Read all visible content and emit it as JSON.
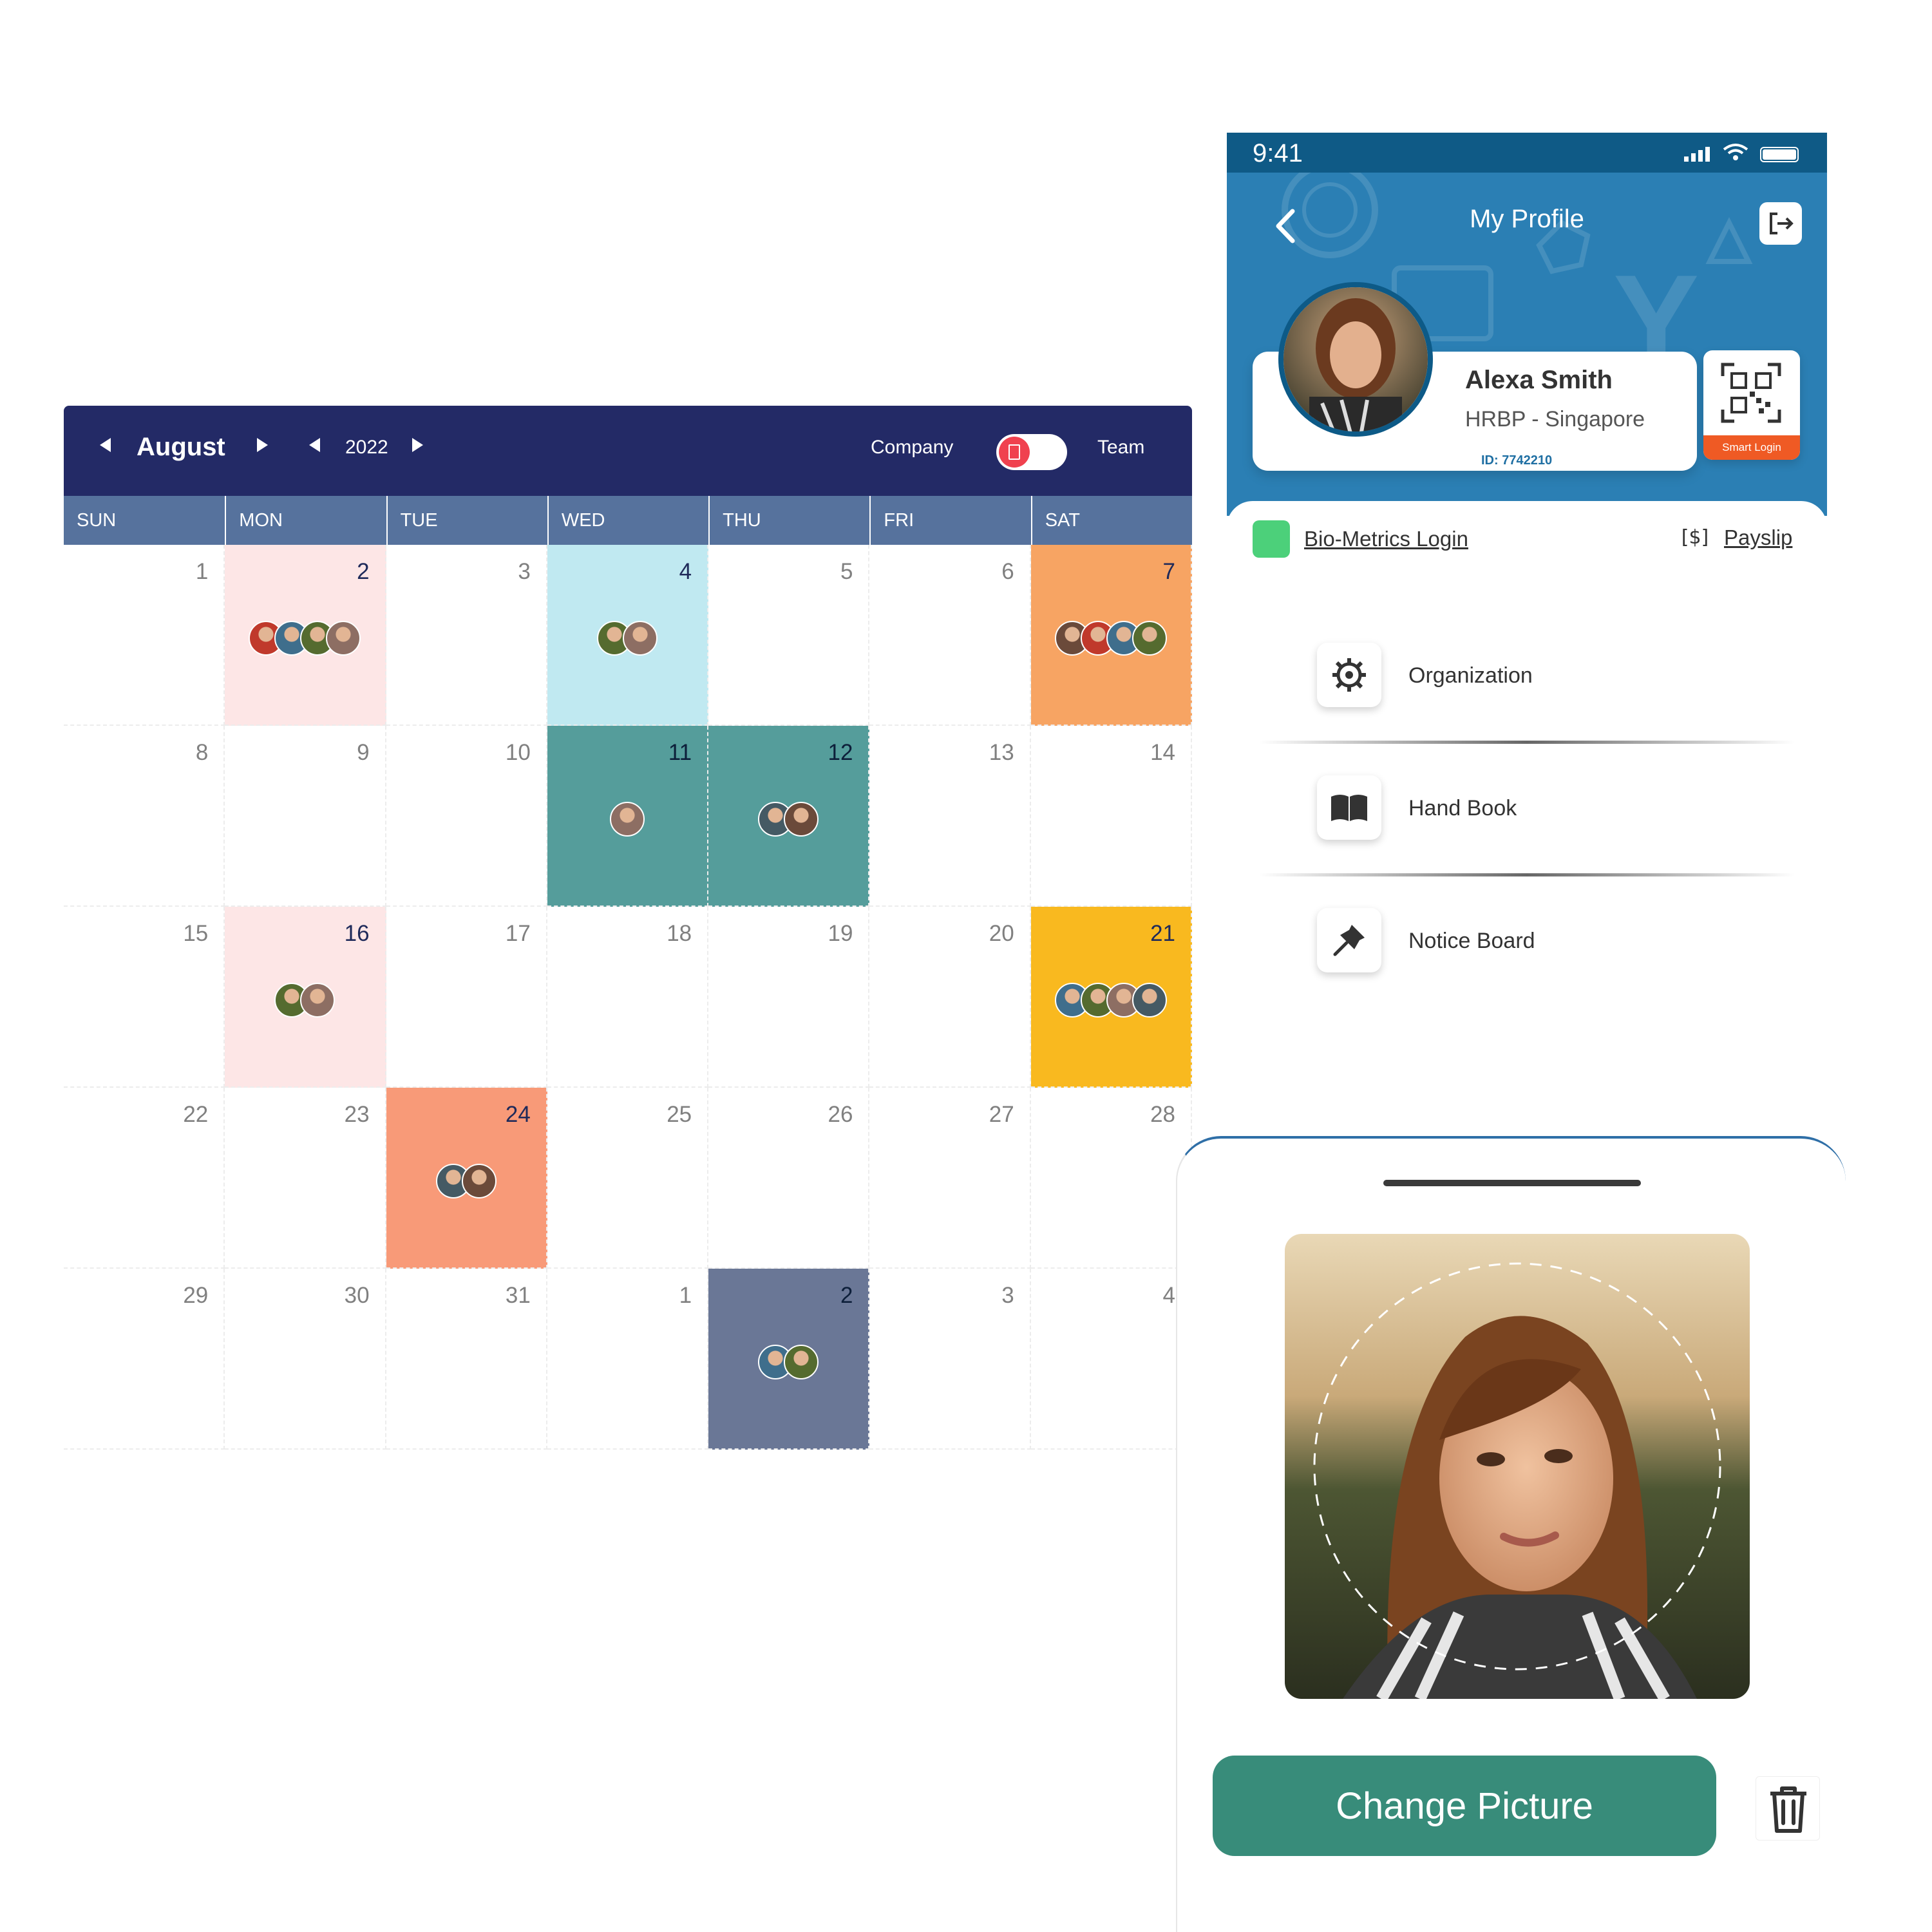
{
  "calendar": {
    "month": "August",
    "year": "2022",
    "toggle_left": "Company",
    "toggle_right": "Team",
    "weekdays": [
      "SUN",
      "MON",
      "TUE",
      "WED",
      "THU",
      "FRI",
      "SAT"
    ],
    "days": [
      {
        "n": "1"
      },
      {
        "n": "2",
        "bg": "#fde6e6",
        "av": 4
      },
      {
        "n": "3"
      },
      {
        "n": "4",
        "bg": "#c0e9f1",
        "av": 2
      },
      {
        "n": "5"
      },
      {
        "n": "6"
      },
      {
        "n": "7",
        "bg": "#f7a463",
        "av": 4
      },
      {
        "n": "8"
      },
      {
        "n": "9"
      },
      {
        "n": "10"
      },
      {
        "n": "11",
        "bg": "#559d9b",
        "av": 1,
        "dark": true
      },
      {
        "n": "12",
        "bg": "#559d9b",
        "av": 2,
        "dark": true
      },
      {
        "n": "13"
      },
      {
        "n": "14"
      },
      {
        "n": "15"
      },
      {
        "n": "16",
        "bg": "#fde6e6",
        "av": 2
      },
      {
        "n": "17"
      },
      {
        "n": "18"
      },
      {
        "n": "19"
      },
      {
        "n": "20"
      },
      {
        "n": "21",
        "bg": "#f9b91f",
        "av": 4
      },
      {
        "n": "22"
      },
      {
        "n": "23"
      },
      {
        "n": "24",
        "bg": "#f89a78",
        "av": 2
      },
      {
        "n": "25"
      },
      {
        "n": "26"
      },
      {
        "n": "27"
      },
      {
        "n": "28"
      },
      {
        "n": "29"
      },
      {
        "n": "30"
      },
      {
        "n": "31"
      },
      {
        "n": "1"
      },
      {
        "n": "2",
        "bg": "#6a7796",
        "av": 2,
        "dark": true
      },
      {
        "n": "3"
      },
      {
        "n": "4"
      }
    ]
  },
  "phone": {
    "time": "9:41",
    "title": "My Profile",
    "name": "Alexa Smith",
    "role": "HRBP - Singapore",
    "id": "ID: 7742210",
    "smart_login": "Smart Login",
    "bio_login": "Bio-Metrics Login",
    "payslip": "Payslip",
    "menu": [
      {
        "label": "Organization",
        "icon": "organization-gear-icon"
      },
      {
        "label": "Hand Book",
        "icon": "book-icon"
      },
      {
        "label": "Notice Board",
        "icon": "pin-icon"
      }
    ]
  },
  "sheet": {
    "button": "Change Picture",
    "trash_icon": "trash-icon"
  },
  "colors": {
    "calendar_header": "#232a66",
    "weekday_row": "#56729d",
    "profile_blue": "#2b7fb4",
    "button_green": "#388c7a",
    "toggle_red": "#f0414f"
  }
}
